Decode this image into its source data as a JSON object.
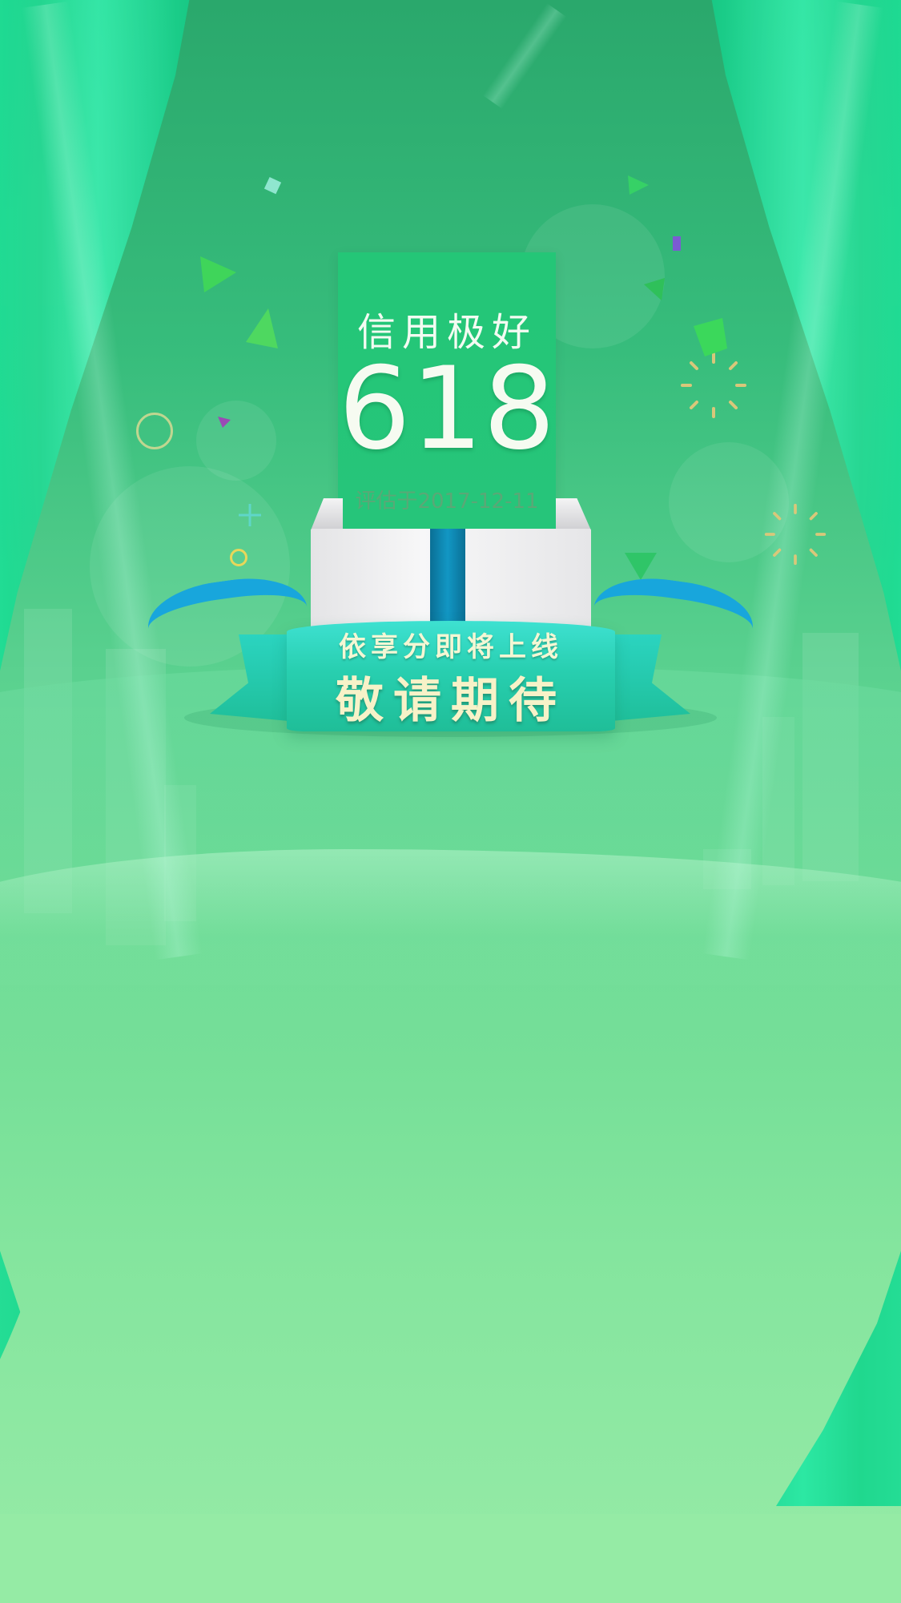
{
  "card": {
    "title": "信用极好",
    "score": "618",
    "date": "评估于2017-12-11"
  },
  "banner": {
    "line1": "依享分即将上线",
    "line2": "敬请期待"
  },
  "colors": {
    "card_bg": "#24c677",
    "ribbon_blue": "#18a6dc",
    "banner_teal": "#28cfb0",
    "banner_text": "#f7f2c8"
  }
}
